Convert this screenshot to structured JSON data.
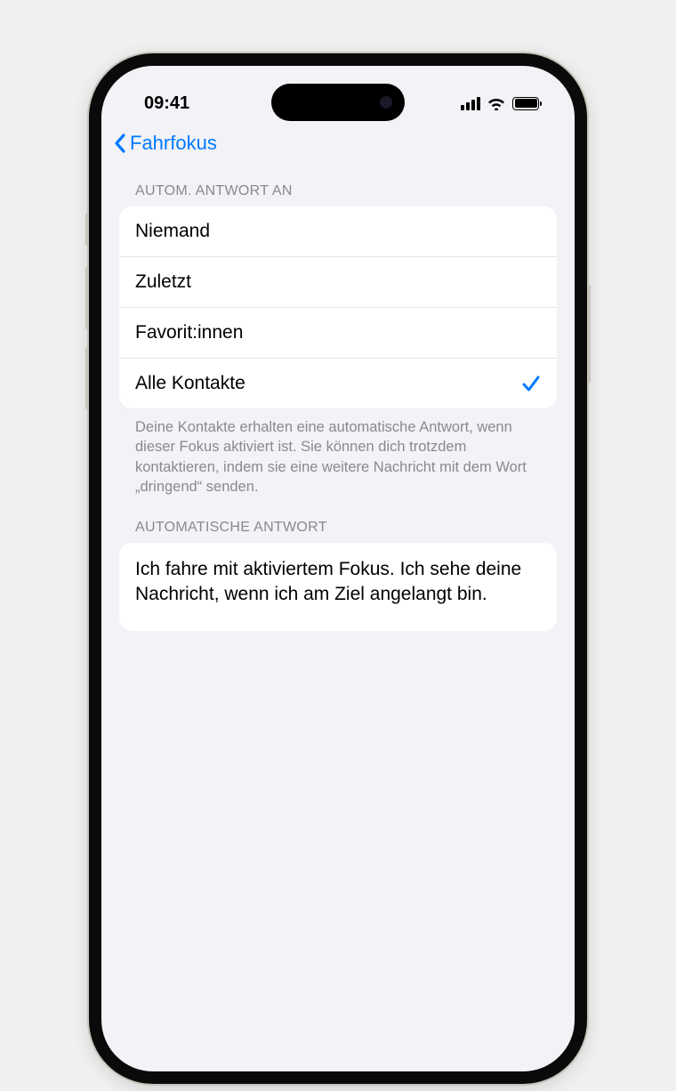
{
  "status": {
    "time": "09:41"
  },
  "nav": {
    "back_label": "Fahrfokus"
  },
  "section1": {
    "header": "AUTOM. ANTWORT AN",
    "options": [
      {
        "label": "Niemand",
        "selected": false
      },
      {
        "label": "Zuletzt",
        "selected": false
      },
      {
        "label": "Favorit:innen",
        "selected": false
      },
      {
        "label": "Alle Kontakte",
        "selected": true
      }
    ],
    "footer": "Deine Kontakte erhalten eine automatische Antwort, wenn dieser Fokus aktiviert ist. Sie können dich trotzdem kontaktieren, indem sie eine weitere Nachricht mit dem Wort „dringend“ senden."
  },
  "section2": {
    "header": "AUTOMATISCHE ANTWORT",
    "message": "Ich fahre mit aktiviertem Fokus. Ich sehe deine Nachricht, wenn ich am Ziel angelangt bin."
  }
}
